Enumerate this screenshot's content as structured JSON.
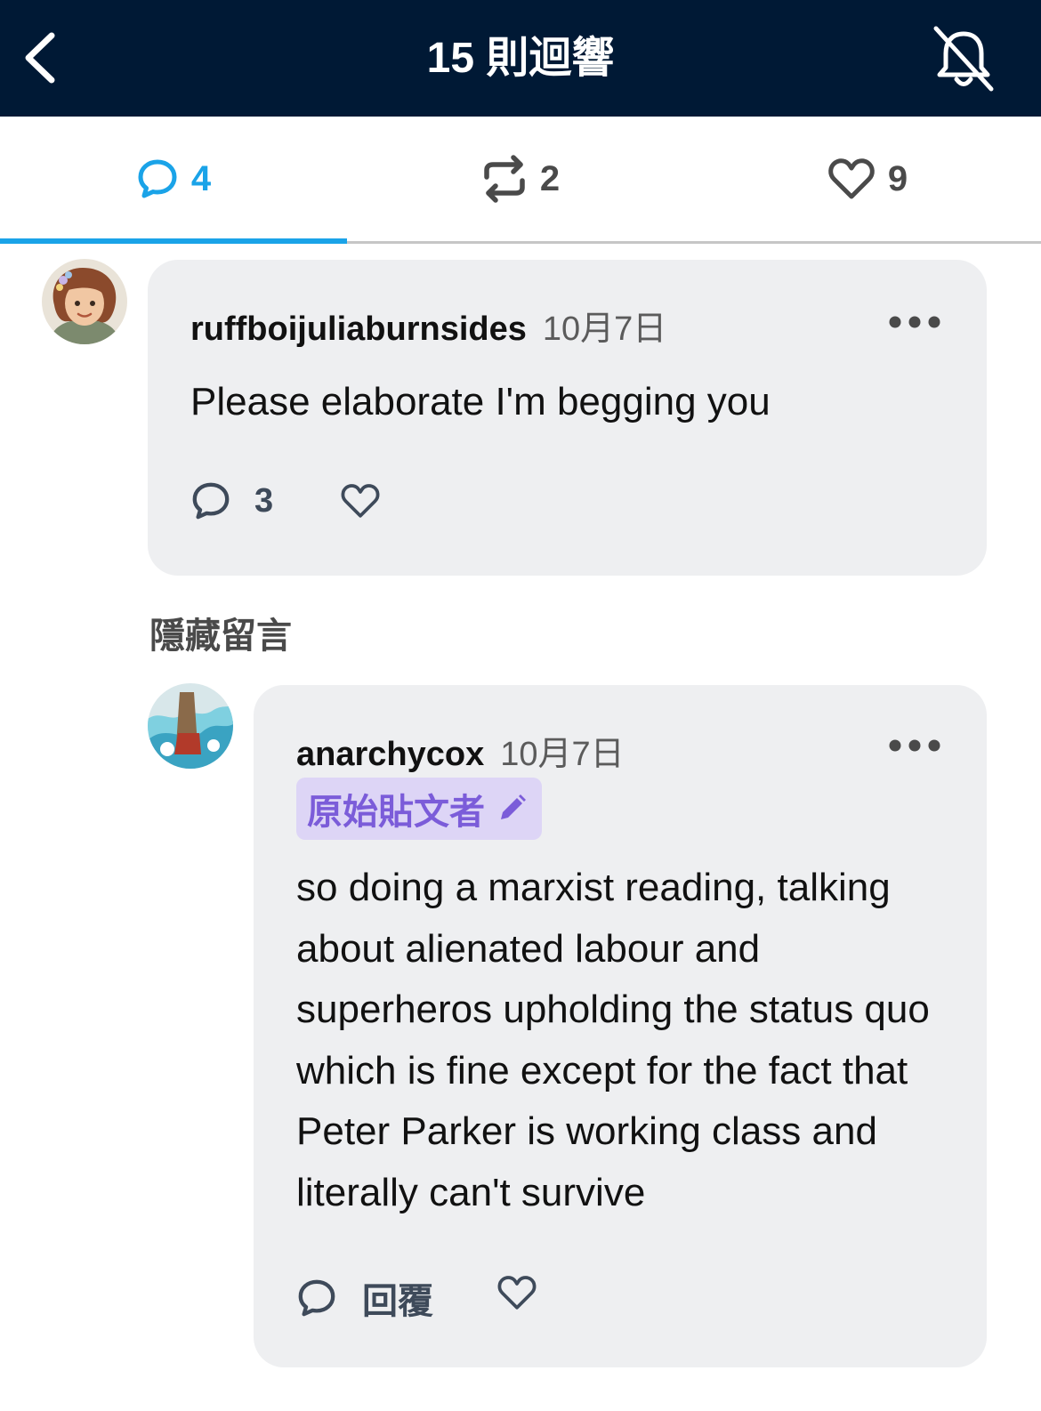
{
  "header": {
    "title": "15 則迴響",
    "back_icon": "chevron-left-icon",
    "notifications_icon": "bell-off-icon"
  },
  "tabs": [
    {
      "icon": "comment-icon",
      "count": "4",
      "active": true
    },
    {
      "icon": "reblog-icon",
      "count": "2",
      "active": false
    },
    {
      "icon": "heart-icon",
      "count": "9",
      "active": false
    }
  ],
  "comments": [
    {
      "username": "ruffboijuliaburnsides",
      "date": "10月7日",
      "text": "Please elaborate I'm begging you",
      "reply_count": "3"
    },
    {
      "username": "anarchycox",
      "date": "10月7日",
      "badge": "原始貼文者",
      "text": "so doing a marxist reading, talking about alienated labour and superheros upholding the status quo which is fine except for the fact that Peter Parker is working class and literally can't survive",
      "reply_label": "回覆"
    }
  ],
  "hidden_comments_label": "隱藏留言",
  "colors": {
    "header_bg": "#001935",
    "accent": "#1aa3e8",
    "bubble_bg": "#eeeff1",
    "badge_bg": "#ddd5f6",
    "badge_text": "#7b5cd9"
  }
}
